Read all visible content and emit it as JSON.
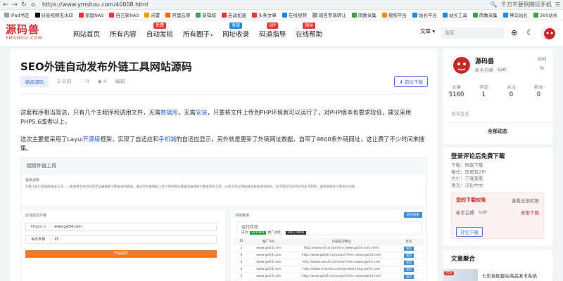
{
  "browser": {
    "url": "https://www.ymshou.com/40008.html",
    "right_text": "千万不要倒腾玩手机",
    "bookmarks": [
      {
        "label": "iPad书签",
        "color": "#9e9e9e"
      },
      {
        "label": "抖音视频无水印",
        "color": "#111111"
      },
      {
        "label": "家庭NAS",
        "color": "#e53935"
      },
      {
        "label": "自己家NAS",
        "color": "#e53935"
      },
      {
        "label": "闲置",
        "color": "#ff9800"
      },
      {
        "label": "阿里云原",
        "color": "#ff6a00"
      },
      {
        "label": "新知城",
        "color": "#43a047"
      },
      {
        "label": "启动加速",
        "color": "#e53935"
      },
      {
        "label": "头条文章",
        "color": "#e53935"
      },
      {
        "label": "在线视频",
        "color": "#1e88e5"
      },
      {
        "label": "域名专场转让",
        "color": "#9e9e9e"
      },
      {
        "label": "简数采集",
        "color": "#43a047"
      },
      {
        "label": "搜狗平台",
        "color": "#fb8c00"
      },
      {
        "label": "站长平台",
        "color": "#1e88e5"
      },
      {
        "label": "站长工具",
        "color": "#1e88e5"
      },
      {
        "label": "简数采集",
        "color": "#43a047"
      },
      {
        "label": "神马站长",
        "color": "#1e88e5"
      },
      {
        "label": "360站长",
        "color": "#43a047"
      }
    ]
  },
  "site": {
    "logo_text": "源码兽",
    "logo_sub": "YMSHOU.COM",
    "nav": [
      {
        "label": "网站首页"
      },
      {
        "label": "所有内容"
      },
      {
        "label": "自动发帖",
        "tag": "免费",
        "tag_color": "red"
      },
      {
        "label": "所有圈子",
        "caret": true
      },
      {
        "label": "网址收录",
        "tag": "发链",
        "tag_color": "blue"
      },
      {
        "label": "码道指导",
        "tag": "VIP",
        "tag_color": "red"
      },
      {
        "label": "在线帮助",
        "tag": "指导",
        "tag_color": "red"
      }
    ],
    "search_select": "文章",
    "search_placeholder": "搜索"
  },
  "article": {
    "title": "SEO外链自动发布外链工具网站源码",
    "category": "精品源码",
    "time": "3 天前",
    "likes": "0",
    "views": "4",
    "edit": "编辑",
    "goto_download": "前往下载",
    "para1_a": "这套程序相当简洁，只有几个主程序和调用文件，无需",
    "para1_link1": "数据库",
    "para1_b": "，无需",
    "para1_link2": "安装",
    "para1_c": "，只要将文件上传到PHP环境就可以运行了，对PHP版本也要求较低，建议采用PHP5.6或者以上。",
    "para2_a": "这次主要是采用了Layui",
    "para2_link1": "开源版",
    "para2_b": "框架，实现了自适应和",
    "para2_link2": "手机端",
    "para2_c": "的自适应显示，另外就是更新了外链网址数据，自带了9600条外链网址，这让费了不少时间来搜集。"
  },
  "shot": {
    "title": "超级外链工具",
    "intro_title": "程序说明",
    "intro_text": "外链工具只是辅助收录工具，一般适用于短时间内无法被搜索引擎收录的新站，通过在外链网站上留下你的网址来提高被搜索引擎发现的几率，从而达到让网站被快速收录的目的。但不建议在短时间内多次使用，避免被搜索引擎视为作弊。",
    "form_title": "在线提交外链",
    "url_label": "http(s)://",
    "url_value": "www.gw54.com",
    "count_label": "每页条数",
    "count_value": "15",
    "submit_label": "开始提交",
    "right_title": "外链链接",
    "right_button": "提交链接",
    "run_title": "运行状态",
    "run_status_label": "成功",
    "run_done": "151/161",
    "run_progress_label": "推广进度：",
    "run_progress": "240 / 9602",
    "run_colors": {
      "done": "#20a53a",
      "progress": "#333333"
    },
    "table_headers": [
      "ID",
      "推广URL",
      "外链提交网址",
      "状态"
    ],
    "table_rows": [
      {
        "id": "1",
        "url": "www.gw54.com",
        "link": "http://www.ic0.cn/gmh/ro_www.gw54.com.html",
        "status": "成功"
      },
      {
        "id": "2",
        "url": "www.gw54.com",
        "link": "http://www.gw54.com/aspx/?site=www.gw54.com",
        "status": "成功"
      },
      {
        "id": "3",
        "url": "www.gw54.com",
        "link": "http://www.seovd.com/seo/?site=www.gw54.com",
        "status": "成功"
      },
      {
        "id": "4",
        "url": "www.gw54.com",
        "link": "http://www.cheyilou.com/go/down/tog.gw54.com",
        "status": "成功"
      },
      {
        "id": "5",
        "url": "www.gw54.com",
        "link": "http://www.gw54.com/aspx/?site=www.gw54.com",
        "status": "成功"
      }
    ]
  },
  "sidebar": {
    "author_name": "源码兽",
    "author_sub": "新手白嫖",
    "author_level": "Lv0",
    "score": "100",
    "score_unit": "%",
    "stats": [
      {
        "label": "文章",
        "value": "5160"
      },
      {
        "label": "评论",
        "value": "1"
      },
      {
        "label": "关注",
        "value": "0"
      },
      {
        "label": "粉丝",
        "value": "0"
      }
    ],
    "signature": "没有签名",
    "all_posts": "全部动态",
    "download_title": "登录评论后免费下载",
    "download_items": [
      "下载：网盘下载",
      "格式：压缩包ZIP",
      "大小：下载查看",
      "语言：汉化中文"
    ],
    "perm_title": "您的下载权限",
    "perm_link": "查看全部权限",
    "perm_user": "新手白嫖",
    "perm_level": "Lv0",
    "perm_free": "无限下载",
    "perm_button": "评论下载",
    "recommend_title": "文章聚合",
    "recommend_badge": "TOP",
    "recommend_article": "七彩自助建站商品发卡系统"
  }
}
